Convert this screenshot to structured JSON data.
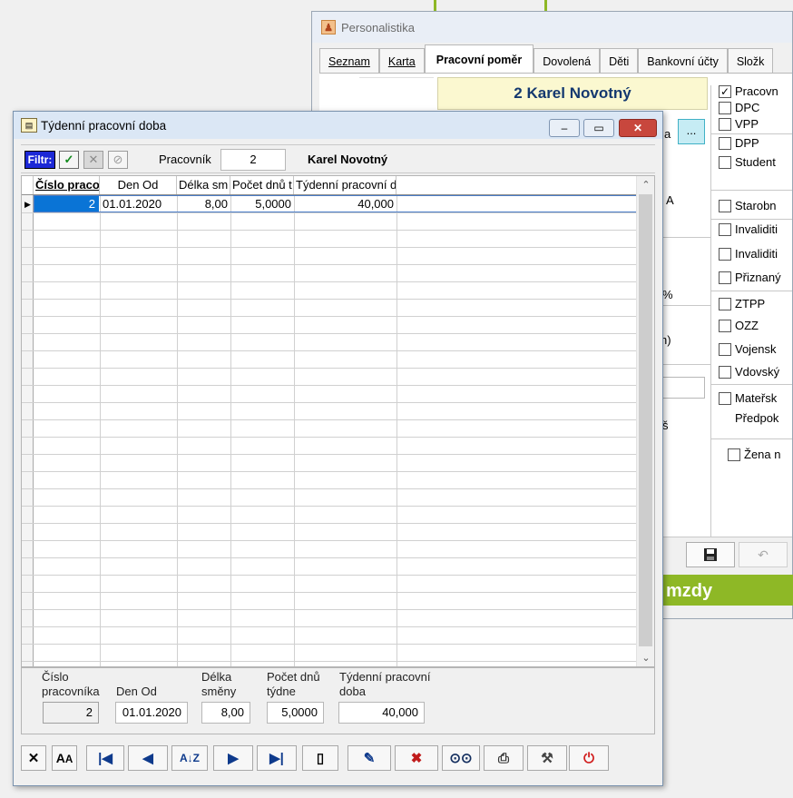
{
  "background_window": {
    "title": "Personalistika",
    "tabs": [
      "Seznam",
      "Karta",
      "Pracovní poměr",
      "Dovolená",
      "Děti",
      "Bankovní účty",
      "Složk"
    ],
    "employee_banner": "2 Karel Novotný",
    "dots_button": "...",
    "stray_texts": [
      "a",
      "A",
      "%",
      "h)",
      "š"
    ],
    "checkboxes": [
      {
        "label": "Pracovn",
        "checked": true
      },
      {
        "label": "DPC",
        "checked": false
      },
      {
        "label": "VPP",
        "checked": false
      },
      {
        "label": "DPP",
        "checked": false
      },
      {
        "label": "Student",
        "checked": false
      },
      {
        "label": "Starobn",
        "checked": false
      },
      {
        "label": "Invaliditi",
        "checked": false
      },
      {
        "label": "Invaliditi",
        "checked": false
      },
      {
        "label": "Přiznaný",
        "checked": false
      },
      {
        "label": "ZTPP",
        "checked": false
      },
      {
        "label": "OZZ",
        "checked": false
      },
      {
        "label": "Vojensk",
        "checked": false
      },
      {
        "label": "Vdovský",
        "checked": false
      },
      {
        "label": "Mateřsk",
        "checked": false
      },
      {
        "label": "Žena n",
        "checked": false
      }
    ],
    "predpok_label": "Předpok",
    "green_banner": "mzdy"
  },
  "dialog": {
    "title": "Týdenní pracovní doba",
    "window_buttons": {
      "minimize": "–",
      "maximize": "▭",
      "close": "✕"
    },
    "filter": {
      "filter_label": "Filtr:",
      "employee_label": "Pracovník",
      "employee_number": "2",
      "employee_name": "Karel Novotný"
    },
    "grid": {
      "columns": [
        "Číslo praco",
        "Den Od",
        "Délka sm",
        "Počet dnů t",
        "Týdenní pracovní d"
      ],
      "rows": [
        [
          "2",
          "01.01.2020",
          "8,00",
          "5,0000",
          "40,000"
        ]
      ]
    },
    "detail": {
      "cislo_label": "Číslo pracovníka",
      "den_od_label": "Den Od",
      "delka_label": "Délka směny",
      "pocet_label": "Počet dnů týdne",
      "tydenni_label": "Týdenní pracovní doba",
      "cislo_value": "2",
      "den_od_value": "01.01.2020",
      "delka_value": "8,00",
      "pocet_value": "5,0000",
      "tydenni_value": "40,000"
    },
    "toolbar": [
      "close",
      "font",
      "first",
      "previous",
      "sort",
      "next",
      "last",
      "new",
      "edit",
      "delete",
      "find",
      "print",
      "tools",
      "exit"
    ]
  }
}
